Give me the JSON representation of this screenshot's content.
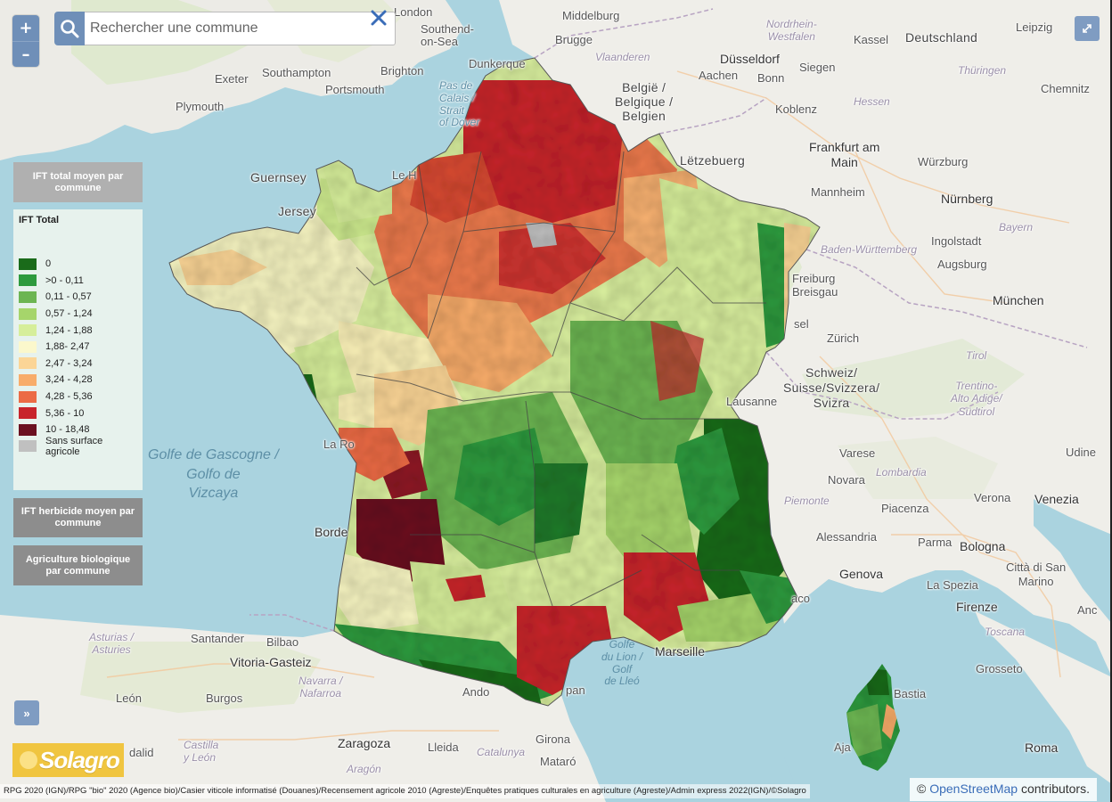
{
  "search": {
    "placeholder": "Rechercher une commune"
  },
  "zoom": {
    "in_label": "+",
    "out_label": "–"
  },
  "layers": [
    {
      "label": "IFT total moyen par commune",
      "active": true
    },
    {
      "label": "IFT herbicide moyen par commune",
      "active": false
    },
    {
      "label": "Agriculture biologique par commune",
      "active": false
    }
  ],
  "legend": {
    "title": "IFT Total",
    "items": [
      {
        "label": "0",
        "color": "#1a6b1a"
      },
      {
        "label": ">0 - 0,11",
        "color": "#2e9a3e"
      },
      {
        "label": "0,11 - 0,57",
        "color": "#6cb552"
      },
      {
        "label": "0,57 - 1,24",
        "color": "#a6d56b"
      },
      {
        "label": "1,24 - 1,88",
        "color": "#d6ee9a"
      },
      {
        "label": "1,88- 2,47",
        "color": "#fbf8cc"
      },
      {
        "label": "2,47 - 3,24",
        "color": "#fbd596"
      },
      {
        "label": "3,24 - 4,28",
        "color": "#f8ac6a"
      },
      {
        "label": "4,28 - 5,36",
        "color": "#ec6b45"
      },
      {
        "label": "5,36 - 10",
        "color": "#c8242b"
      },
      {
        "label": "10 - 18,48",
        "color": "#6b1020"
      },
      {
        "label": "Sans surface agricole",
        "color": "#c0c0c0"
      }
    ]
  },
  "expand_label": "»",
  "logo": {
    "text": "Solagro"
  },
  "footer": {
    "sources": "RPG 2020 (IGN)/RPG \"bio\" 2020 (Agence bio)/Casier viticole informatisé (Douanes)/Recensement agricole 2010 (Agreste)/Enquêtes pratiques culturales en agriculture (Agreste)/Admin express 2022(IGN)/©Solagro",
    "attribution_prefix": "©",
    "attribution_link": "OpenStreetMap",
    "attribution_suffix": "contributors."
  },
  "places": {
    "london": "London",
    "southend": "Southend-\non-Sea",
    "southampton": "Southampton",
    "brighton": "Brighton",
    "exeter": "Exeter",
    "portsmouth": "Portsmouth",
    "plymouth": "Plymouth",
    "dunkerque": "Dunkerque",
    "pas_de_calais": "Pas de\nCalais /\nStrait\nof Dover",
    "middelburg": "Middelburg",
    "brugge": "Brugge",
    "vlaanderen": "Vlaanderen",
    "belgie": "België /\nBelgique /\nBelgien",
    "dusseldorf": "Düsseldorf",
    "aachen": "Aachen",
    "bonn": "Bonn",
    "koblenz": "Koblenz",
    "siegen": "Siegen",
    "kassel": "Kassel",
    "deutschland": "Deutschland",
    "leipzig": "Leipzig",
    "nordrhein": "Nordrhein-\nWestfalen",
    "thuringen": "Thüringen",
    "hessen": "Hessen",
    "chemnitz": "Chemnitz",
    "frankfurt": "Frankfurt am\nMain",
    "letzebuerg": "Lëtzebuerg",
    "wurzburg": "Würzburg",
    "mannheim": "Mannheim",
    "nurnberg": "Nürnberg",
    "bayern": "Bayern",
    "ingolstadt": "Ingolstadt",
    "baden": "Baden-Württemberg",
    "augsburg": "Augsburg",
    "munchen": "München",
    "freiburg": "Freiburg\nBreisgau",
    "basel": "sel",
    "zurich": "Zürich",
    "schweiz": "Schweiz/\nSuisse/Svizzera/\nSvizra",
    "tirol": "Tirol",
    "trentino": "Trentino-\nAlto Adige/\nSüdtirol",
    "lausanne": "Lausanne",
    "varese": "Varese",
    "lombardia": "Lombardia",
    "novara": "Novara",
    "udine": "Udine",
    "piemonte": "Piemonte",
    "piacenza": "Piacenza",
    "verona": "Verona",
    "venezia": "Venezia",
    "alessandria": "Alessandria",
    "parma": "Parma",
    "bologna": "Bologna",
    "genova": "Genova",
    "citta_san_marino": "Città di San\nMarino",
    "la_spezia": "La Spezia",
    "firenze": "Firenze",
    "ancona": "Anc",
    "toscana": "Toscana",
    "grosseto": "Grosseto",
    "roma": "Roma",
    "monaco": "aco",
    "guernsey": "Guernsey",
    "jersey": "Jersey",
    "le_havre": "Le H",
    "golfe_gascogne": "Golfe de Gascogne /\nGolfo de\nVizcaya",
    "la_rochelle": "La Ro",
    "bordeaux": "Borde",
    "golfe_lion": "Golfe\ndu Lion /\nGolf\nde Lleó",
    "marseille": "Marseille",
    "andorra": "Ando",
    "perpignan": "pan",
    "santander": "Santander",
    "bilbao": "Bilbao",
    "asturias": "Asturias /\nAsturies",
    "vitoria": "Vitoria-Gasteiz",
    "navarra": "Navarra /\nNafarroa",
    "burgos": "Burgos",
    "leon": "León",
    "castilla": "Castilla\ny León",
    "valladolid": "dalid",
    "zaragoza": "Zaragoza",
    "aragon": "Aragón",
    "lleida": "Lleida",
    "girona": "Girona",
    "catalunya": "Catalunya",
    "mataro": "Mataró",
    "ajaccio": "Aja",
    "bastia": "Bastia"
  }
}
